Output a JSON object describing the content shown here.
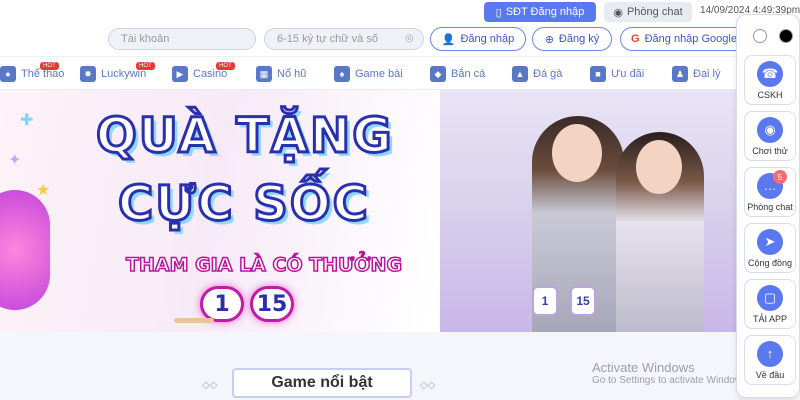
{
  "topbar": {
    "sdt_login_label": "SĐT Đăng nhập",
    "chat_room_label": "Phòng chat",
    "datetime": "14/09/2024 4:49:39pm"
  },
  "login": {
    "username_placeholder": "Tài khoản",
    "password_placeholder": "6-15 ký tự chữ và số",
    "login_label": "Đăng nhập",
    "register_label": "Đăng ký",
    "google_label": "Đăng nhập Google"
  },
  "nav": {
    "items": [
      {
        "label": "Thể thao",
        "icon": "sports-icon",
        "hot": "HOT"
      },
      {
        "label": "Luckywin",
        "icon": "luckywin-icon",
        "hot": "HOT"
      },
      {
        "label": "Casino",
        "icon": "casino-icon",
        "hot": "HOT"
      },
      {
        "label": "Nổ hũ",
        "icon": "slot-icon",
        "hot": ""
      },
      {
        "label": "Game bài",
        "icon": "cards-icon",
        "hot": ""
      },
      {
        "label": "Bắn cá",
        "icon": "fish-icon",
        "hot": ""
      },
      {
        "label": "Đá gà",
        "icon": "rooster-icon",
        "hot": ""
      },
      {
        "label": "Ưu đãi",
        "icon": "gift-icon",
        "hot": ""
      },
      {
        "label": "Đại lý",
        "icon": "agent-icon",
        "hot": ""
      }
    ]
  },
  "banner": {
    "title_line1": "QUÀ TẶNG",
    "title_line2": "CỰC SỐC",
    "subtitle": "THAM GIA LÀ CÓ THƯỞNG",
    "date_day": "1",
    "date_month": "15",
    "chip1": "1",
    "chip2": "15"
  },
  "section": {
    "title": "Game nổi bật"
  },
  "watermark": {
    "line1": "Activate Windows",
    "line2": "Go to Settings to activate Windows."
  },
  "sidebar": {
    "items": [
      {
        "label": "CSKH",
        "icon": "support-icon",
        "badge": ""
      },
      {
        "label": "Chơi thử",
        "icon": "trial-icon",
        "badge": ""
      },
      {
        "label": "Phòng chat",
        "icon": "chat-icon",
        "badge": "5"
      },
      {
        "label": "Cộng đồng",
        "icon": "telegram-icon",
        "badge": ""
      },
      {
        "label": "TẢI APP",
        "icon": "app-icon",
        "badge": ""
      },
      {
        "label": "Về đầu",
        "icon": "arrow-up-icon",
        "badge": ""
      }
    ]
  },
  "colors": {
    "accent": "#5a78f0",
    "nav_text": "#5a78c8",
    "hot_badge": "#e53935",
    "title_stroke": "#2a2fb0",
    "subtitle_stroke": "#b8139a"
  }
}
